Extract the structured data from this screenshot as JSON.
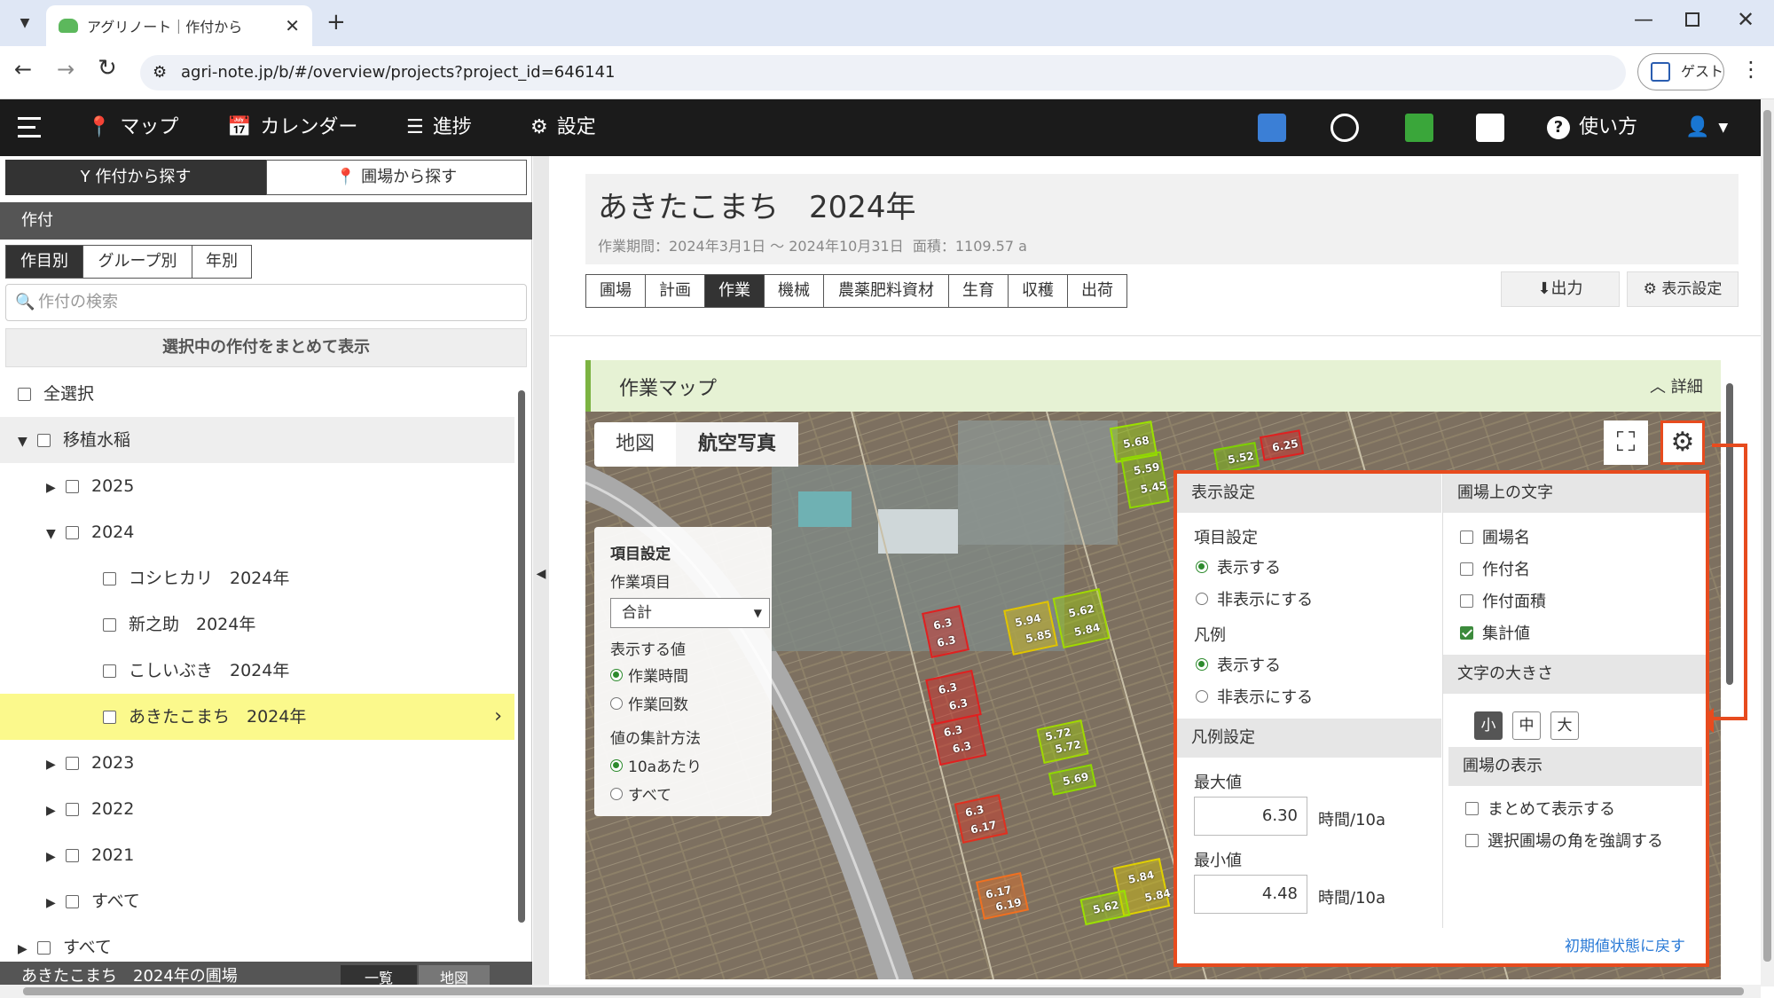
{
  "browser": {
    "tab_title": "アグリノート｜作付から",
    "url": "agri-note.jp/b/#/overview/projects?project_id=646141",
    "guest_label": "ゲスト"
  },
  "nav": {
    "map": "マップ",
    "calendar": "カレンダー",
    "progress": "進捗",
    "settings": "設定",
    "help": "使い方"
  },
  "left": {
    "tab_crop": "作付から探す",
    "tab_field": "圃場から探す",
    "section": "作付",
    "seg": [
      "作目別",
      "グループ別",
      "年別"
    ],
    "search_placeholder": "作付の検索",
    "show_selected": "選択中の作付をまとめて表示",
    "tree": [
      {
        "label": "全選択"
      },
      {
        "label": "移植水稲"
      },
      {
        "label": "2025"
      },
      {
        "label": "2024"
      },
      {
        "label": "コシヒカリ　2024年"
      },
      {
        "label": "新之助　2024年"
      },
      {
        "label": "こしいぶき　2024年"
      },
      {
        "label": "あきたこまち　2024年"
      },
      {
        "label": "2023"
      },
      {
        "label": "2022"
      },
      {
        "label": "2021"
      },
      {
        "label": "すべて"
      },
      {
        "label": "すべて"
      }
    ],
    "footer_title": "あきたこまち　2024年の圃場",
    "footer_list": "一覧",
    "footer_map": "地図"
  },
  "project": {
    "title": "あきたこまち　2024年",
    "period": "作業期間：2024年3月1日 〜 2024年10月31日",
    "area": "面積：1109.57 a",
    "tabs": [
      "圃場",
      "計画",
      "作業",
      "機械",
      "農薬肥料資材",
      "生育",
      "収穫",
      "出荷"
    ],
    "export": "出力",
    "display_settings": "表示設定"
  },
  "workmap": {
    "title": "作業マップ",
    "detail": "詳細",
    "map_tab": "地図",
    "aerial_tab": "航空写真"
  },
  "item_panel": {
    "title": "項目設定",
    "work_item_label": "作業項目",
    "work_item_value": "合計",
    "display_value_label": "表示する値",
    "opt_time": "作業時間",
    "opt_count": "作業回数",
    "agg_label": "値の集計方法",
    "opt_per10a": "10aあたり",
    "opt_all": "すべて"
  },
  "popup": {
    "display_settings": "表示設定",
    "item_settings": "項目設定",
    "show": "表示する",
    "hide": "非表示にする",
    "legend": "凡例",
    "legend_show": "表示する",
    "legend_hide": "非表示にする",
    "legend_settings": "凡例設定",
    "max_label": "最大値",
    "max_value": "6.30",
    "min_label": "最小値",
    "min_value": "4.48",
    "unit": "時間/10a",
    "unit2": "時間/10a",
    "field_text": "圃場上の文字",
    "field_name": "圃場名",
    "crop_name": "作付名",
    "crop_area": "作付面積",
    "agg_value": "集計値",
    "text_size": "文字の大きさ",
    "size_small": "小",
    "size_mid": "中",
    "size_large": "大",
    "field_display": "圃場の表示",
    "combine": "まとめて表示する",
    "emphasize": "選択圃場の角を強調する",
    "reset": "初期値状態に戻す"
  },
  "fields": [
    {
      "v1": "5.68",
      "v2": "",
      "color": "#9be000"
    },
    {
      "v1": "5.59",
      "v2": "5.45",
      "color": "#8fd800"
    },
    {
      "v1": "5.52",
      "v2": "",
      "color": "#7ed100"
    },
    {
      "v1": "6.25",
      "v2": "",
      "color": "#e02020"
    },
    {
      "v1": "6.3",
      "v2": "6.3",
      "color": "#e02020"
    },
    {
      "v1": "5.94",
      "v2": "5.85",
      "color": "#e0c400"
    },
    {
      "v1": "5.62",
      "v2": "5.84",
      "color": "#a0d800"
    },
    {
      "v1": "6.3",
      "v2": "6.3",
      "color": "#e02020"
    },
    {
      "v1": "6.3",
      "v2": "6.3",
      "color": "#e02020"
    },
    {
      "v1": "5.72",
      "v2": "5.72",
      "color": "#a0d800"
    },
    {
      "v1": "5.69",
      "v2": "",
      "color": "#8fd800"
    },
    {
      "v1": "6.3",
      "v2": "6.17",
      "color": "#e03020"
    },
    {
      "v1": "6.17",
      "v2": "6.19",
      "color": "#f07020"
    },
    {
      "v1": "5.84",
      "v2": "5.84",
      "color": "#e0d000"
    },
    {
      "v1": "5.62",
      "v2": "",
      "color": "#9be000"
    }
  ]
}
